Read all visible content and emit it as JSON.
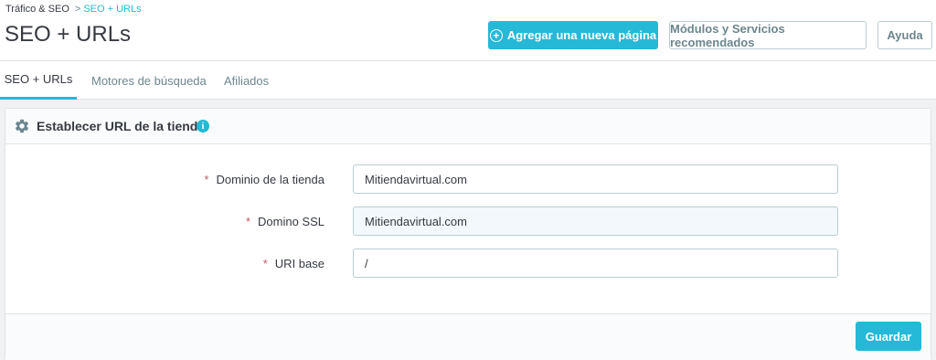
{
  "breadcrumb": {
    "parent": "Tráfico & SEO",
    "separator": ">",
    "current": "SEO + URLs"
  },
  "page_title": "SEO + URLs",
  "toolbar": {
    "add_page_label": "Agregar una nueva página",
    "modules_label": "Módulos y Servicios recomendados",
    "help_label": "Ayuda"
  },
  "tabs": [
    {
      "label": "SEO + URLs",
      "active": true
    },
    {
      "label": "Motores de búsqueda",
      "active": false
    },
    {
      "label": "Afiliados",
      "active": false
    }
  ],
  "panel": {
    "title": "Establecer URL de la tienda",
    "info_symbol": "i",
    "fields": [
      {
        "required_mark": "*",
        "label": "Dominio de la tienda",
        "value": "Mitiendavirtual.com"
      },
      {
        "required_mark": "*",
        "label": "Domino SSL",
        "value": "Mitiendavirtual.com"
      },
      {
        "required_mark": "*",
        "label": "URI base",
        "value": "/"
      }
    ],
    "save_label": "Guardar"
  },
  "colors": {
    "accent": "#25b9d7",
    "required": "#c05c67",
    "text": "#363a41",
    "muted": "#6c868e"
  },
  "icons": {
    "settings": "gear-icon",
    "info": "info-icon",
    "add": "plus-circle-icon"
  }
}
